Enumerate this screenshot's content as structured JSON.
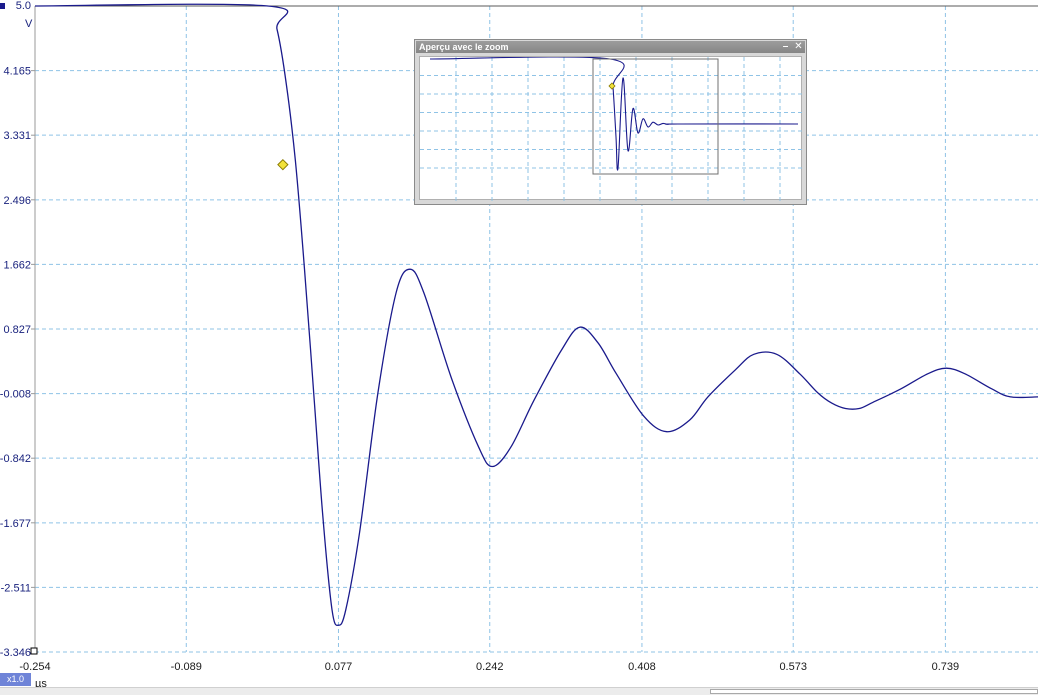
{
  "y_unit": "V",
  "x_unit": "µs",
  "zoom_factor": "x1.0",
  "zoom_overview": {
    "title": "Aperçu avec le zoom",
    "minimize_label": "–",
    "close_label": "✕"
  },
  "colors": {
    "trace": "#1a1a8c",
    "grid": "#8fc3e6",
    "marker": "#f2e23a"
  },
  "chart_data": {
    "type": "line",
    "title": "",
    "xlabel": "µs",
    "ylabel": "V",
    "xlim": [
      -0.254,
      0.84
    ],
    "ylim": [
      -3.346,
      5.0
    ],
    "grid": true,
    "ytick_labels": [
      "5.0",
      "4.165",
      "3.331",
      "2.496",
      "1.662",
      "0.827",
      "-0.008",
      "-0.842",
      "-1.677",
      "-2.511",
      "-3.346"
    ],
    "ytick_values": [
      5.0,
      4.165,
      3.331,
      2.496,
      1.662,
      0.827,
      -0.008,
      -0.842,
      -1.677,
      -2.511,
      -3.346
    ],
    "xtick_labels": [
      "-0.254",
      "-0.089",
      "0.077",
      "0.242",
      "0.408",
      "0.573",
      "0.739"
    ],
    "xtick_values": [
      -0.254,
      -0.089,
      0.077,
      0.242,
      0.408,
      0.573,
      0.739
    ],
    "marker": {
      "x": 0.0,
      "y": 2.95
    },
    "series": [
      {
        "values": [
          [
            -0.254,
            5.0
          ],
          [
            0.0,
            5.0
          ],
          [
            0.01,
            4.7
          ],
          [
            0.02,
            4.0
          ],
          [
            0.03,
            3.0
          ],
          [
            0.04,
            1.6
          ],
          [
            0.05,
            0.0
          ],
          [
            0.06,
            -1.6
          ],
          [
            0.07,
            -2.8
          ],
          [
            0.077,
            -3.0
          ],
          [
            0.085,
            -2.8
          ],
          [
            0.1,
            -1.8
          ],
          [
            0.12,
            0.0
          ],
          [
            0.14,
            1.3
          ],
          [
            0.155,
            1.6
          ],
          [
            0.17,
            1.3
          ],
          [
            0.2,
            0.2
          ],
          [
            0.23,
            -0.7
          ],
          [
            0.245,
            -0.95
          ],
          [
            0.265,
            -0.7
          ],
          [
            0.29,
            -0.1
          ],
          [
            0.32,
            0.55
          ],
          [
            0.34,
            0.85
          ],
          [
            0.36,
            0.65
          ],
          [
            0.38,
            0.25
          ],
          [
            0.41,
            -0.3
          ],
          [
            0.435,
            -0.5
          ],
          [
            0.46,
            -0.35
          ],
          [
            0.48,
            -0.05
          ],
          [
            0.51,
            0.3
          ],
          [
            0.53,
            0.5
          ],
          [
            0.555,
            0.5
          ],
          [
            0.58,
            0.25
          ],
          [
            0.6,
            0.0
          ],
          [
            0.615,
            -0.13
          ],
          [
            0.63,
            -0.2
          ],
          [
            0.645,
            -0.2
          ],
          [
            0.66,
            -0.12
          ],
          [
            0.69,
            0.05
          ],
          [
            0.72,
            0.25
          ],
          [
            0.74,
            0.32
          ],
          [
            0.76,
            0.25
          ],
          [
            0.79,
            0.05
          ],
          [
            0.81,
            -0.05
          ],
          [
            0.84,
            -0.05
          ]
        ]
      }
    ]
  }
}
